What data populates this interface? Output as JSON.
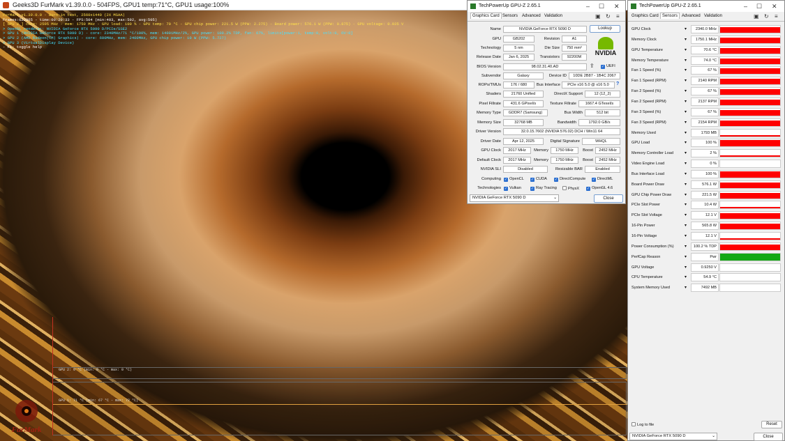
{
  "furmark": {
    "title": "Geeks3D FurMark v1.39.0.0 - 504FPS, GPU1 temp:71°C, GPU1 usage:100%",
    "overlay": [
      {
        "text": "FurMark v1.39.0.0 - Burn-in test, 2560x1440 (2X MSAA)",
        "color": "#ffe04a"
      },
      {
        "text": "Frames:622065 - time:00:20:33 - FPS:504 (min:403, max:592, avg:505)",
        "color": "#ffffff"
      },
      {
        "text": "[ GPU 2 ] core: 2505 MHz - mem: 1750 MHz - GPU load: 100 % - GPU temp: 70 °C - GPU chip power: 221.5 W (PPW: 2.275) - Board power: 576.1 W (PPW: 0.875) - GPU voltage: 0.925 V",
        "color": "#ffe04a"
      },
      {
        "text": "> OpenGL renderer: NVIDIA GeForce RTX 5090 D/PCIe/SSE2",
        "color": "#45e0ff"
      },
      {
        "text": "> GPU 1 (NVIDIA GeForce RTX 5090 D) - core: 2340MHz/71 °C/100%, mem: 14001MHz/2%, GPU power: 100.2% TDP, fan: 67%, limits[power:1, temp:0, volt:0, OV:0]",
        "color": "#45e0ff"
      },
      {
        "text": "> GPU 2 (AMD Radeon(TM) Graphics) - core: 600MHz, mem: 2400MHz, GPU chip power: 10 W (PPW: 5.727)",
        "color": "#45e0ff"
      },
      {
        "text": "> GPU 3 (VirtualDisplay Device)",
        "color": "#45e0ff"
      },
      {
        "text": "- F1: toggle help",
        "color": "#ffffff"
      }
    ],
    "graph1_label": "GPU 2: 0 °C (min: 0 °C - max: 0 °C)",
    "graph2_label": "GPU 1: 71 °C (min: 67 °C - max: 72 °C)",
    "logo_text": "FurMark",
    "colors": {
      "accent_orange": "#e07a1a",
      "temp_line": "#e0a040"
    }
  },
  "gpuz_card": {
    "title": "TechPowerUp GPU-Z 2.65.1",
    "tabs": [
      "Graphics Card",
      "Sensors",
      "Advanced",
      "Validation"
    ],
    "fields": {
      "name": "NVIDIA GeForce RTX 5090 D",
      "lookup": "Lookup",
      "gpu": "GB202",
      "revision": "A1",
      "technology": "5 nm",
      "die_size": "750 mm²",
      "release_date": "Jan 6, 2025",
      "transistors": "92200M",
      "bios": "98.02.31.40.AD",
      "uefi": "UEFI",
      "subvendor": "Galaxy",
      "device_id": "10DE 2B87 - 1B4C 2067",
      "rops": "176 / 680",
      "bus_interface": "PCIe x16 5.0 @ x16 5.0",
      "shaders": "21760 Unified",
      "directx": "12 (12_2)",
      "pixel_fillrate": "431.6 GPixel/s",
      "texture_fillrate": "1667.4 GTexel/s",
      "memory_type": "GDDR7 (Samsung)",
      "bus_width": "512 bit",
      "memory_size": "32768 MB",
      "bandwidth": "1792.0 GB/s",
      "driver_version": "32.0.15.7602 (NVIDIA 576.02) DCH / Win11 64",
      "driver_date": "Apr 12, 2025",
      "digital_signature": "WHQL",
      "gpu_clock": "2017 MHz",
      "memory_clock": "1750 MHz",
      "boost": "2452 MHz",
      "default_clock": "2017 MHz",
      "default_memory": "1750 MHz",
      "default_boost": "2452 MHz",
      "sli": "Disabled",
      "resizable_bar": "Enabled"
    },
    "labels": {
      "name": "Name",
      "gpu": "GPU",
      "revision": "Revision",
      "technology": "Technology",
      "die_size": "Die Size",
      "release_date": "Release Date",
      "transistors": "Transistors",
      "bios": "BIOS Version",
      "subvendor": "Subvendor",
      "device_id": "Device ID",
      "rops": "ROPs/TMUs",
      "bus_interface": "Bus Interface",
      "shaders": "Shaders",
      "directx": "DirectX Support",
      "pixel_fillrate": "Pixel Fillrate",
      "texture_fillrate": "Texture Fillrate",
      "memory_type": "Memory Type",
      "bus_width": "Bus Width",
      "memory_size": "Memory Size",
      "bandwidth": "Bandwidth",
      "driver_version": "Driver Version",
      "driver_date": "Driver Date",
      "digital_signature": "Digital Signature",
      "gpu_clock": "GPU Clock",
      "memory": "Memory",
      "boost": "Boost",
      "default_clock": "Default Clock",
      "sli": "NVIDIA SLI",
      "resizable_bar": "Resizable BAR",
      "computing": "Computing",
      "technologies": "Technologies"
    },
    "computing": [
      "OpenCL",
      "CUDA",
      "DirectCompute",
      "DirectML"
    ],
    "technologies": [
      {
        "name": "Vulkan",
        "checked": true
      },
      {
        "name": "Ray Tracing",
        "checked": true
      },
      {
        "name": "PhysX",
        "checked": false
      },
      {
        "name": "OpenGL 4.6",
        "checked": true
      }
    ],
    "gpu_select": "NVIDIA GeForce RTX 5090 D",
    "close": "Close",
    "vendor_logo": "NVIDIA"
  },
  "gpuz_sensors": {
    "title": "TechPowerUp GPU-Z 2.65.1",
    "tabs": [
      "Graphics Card",
      "Sensors",
      "Advanced",
      "Validation"
    ],
    "rows": [
      {
        "name": "GPU Clock",
        "value": "2340.0 MHz",
        "level": 0.8,
        "color": "#ff0000"
      },
      {
        "name": "Memory Clock",
        "value": "1750.1 MHz",
        "level": 0.8,
        "color": "#ff0000"
      },
      {
        "name": "GPU Temperature",
        "value": "70.6 °C",
        "level": 0.8,
        "color": "#ff0000"
      },
      {
        "name": "Memory Temperature",
        "value": "74.0 °C",
        "level": 0.8,
        "color": "#ff0000"
      },
      {
        "name": "Fan 1 Speed (%)",
        "value": "67 %",
        "level": 0.8,
        "color": "#ff0000"
      },
      {
        "name": "Fan 1 Speed (RPM)",
        "value": "2140 RPM",
        "level": 0.8,
        "color": "#ff0000"
      },
      {
        "name": "Fan 2 Speed (%)",
        "value": "67 %",
        "level": 0.8,
        "color": "#ff0000"
      },
      {
        "name": "Fan 2 Speed (RPM)",
        "value": "2137 RPM",
        "level": 0.8,
        "color": "#ff0000"
      },
      {
        "name": "Fan 3 Speed (%)",
        "value": "67 %",
        "level": 0.8,
        "color": "#ff0000"
      },
      {
        "name": "Fan 3 Speed (RPM)",
        "value": "2154 RPM",
        "level": 0.8,
        "color": "#ff0000"
      },
      {
        "name": "Memory Used",
        "value": "1793 MB",
        "level": 0.05,
        "color": "#ff0000"
      },
      {
        "name": "GPU Load",
        "value": "100 %",
        "level": 0.9,
        "color": "#ff0000"
      },
      {
        "name": "Memory Controller Load",
        "value": "2 %",
        "level": 0.03,
        "color": "#ff0000"
      },
      {
        "name": "Video Engine Load",
        "value": "0 %",
        "level": 0,
        "color": "#ff0000"
      },
      {
        "name": "Bus Interface Load",
        "value": "100 %",
        "level": 0.9,
        "color": "#ff0000"
      },
      {
        "name": "Board Power Draw",
        "value": "576.1 W",
        "level": 0.8,
        "color": "#ff0000"
      },
      {
        "name": "GPU Chip Power Draw",
        "value": "221.5 W",
        "level": 0.8,
        "color": "#ff0000"
      },
      {
        "name": "PCIe Slot Power",
        "value": "10.4 W",
        "level": 0.1,
        "color": "#ff0000"
      },
      {
        "name": "PCIe Slot Voltage",
        "value": "12.1 V",
        "level": 0.8,
        "color": "#ff0000"
      },
      {
        "name": "16-Pin Power",
        "value": "565.8 W",
        "level": 0.8,
        "color": "#ff0000"
      },
      {
        "name": "16-Pin Voltage",
        "value": "12.1 V",
        "level": 0.1,
        "color": "#ff0000"
      },
      {
        "name": "Power Consumption (%)",
        "value": "100.2 % TDP",
        "level": 0.8,
        "color": "#ff0000"
      },
      {
        "name": "PerfCap Reason",
        "value": "Pwr",
        "level": 1,
        "color": "#13a813"
      },
      {
        "name": "GPU Voltage",
        "value": "0.9250 V",
        "level": 0,
        "color": "#ff0000"
      },
      {
        "name": "CPU Temperature",
        "value": "54.9 °C",
        "level": 0,
        "color": "#ff0000"
      },
      {
        "name": "System Memory Used",
        "value": "7492 MB",
        "level": 0,
        "color": "#ff0000"
      }
    ],
    "log_label": "Log to file",
    "reset": "Reset",
    "gpu_select": "NVIDIA GeForce RTX 5090 D",
    "close": "Close"
  }
}
